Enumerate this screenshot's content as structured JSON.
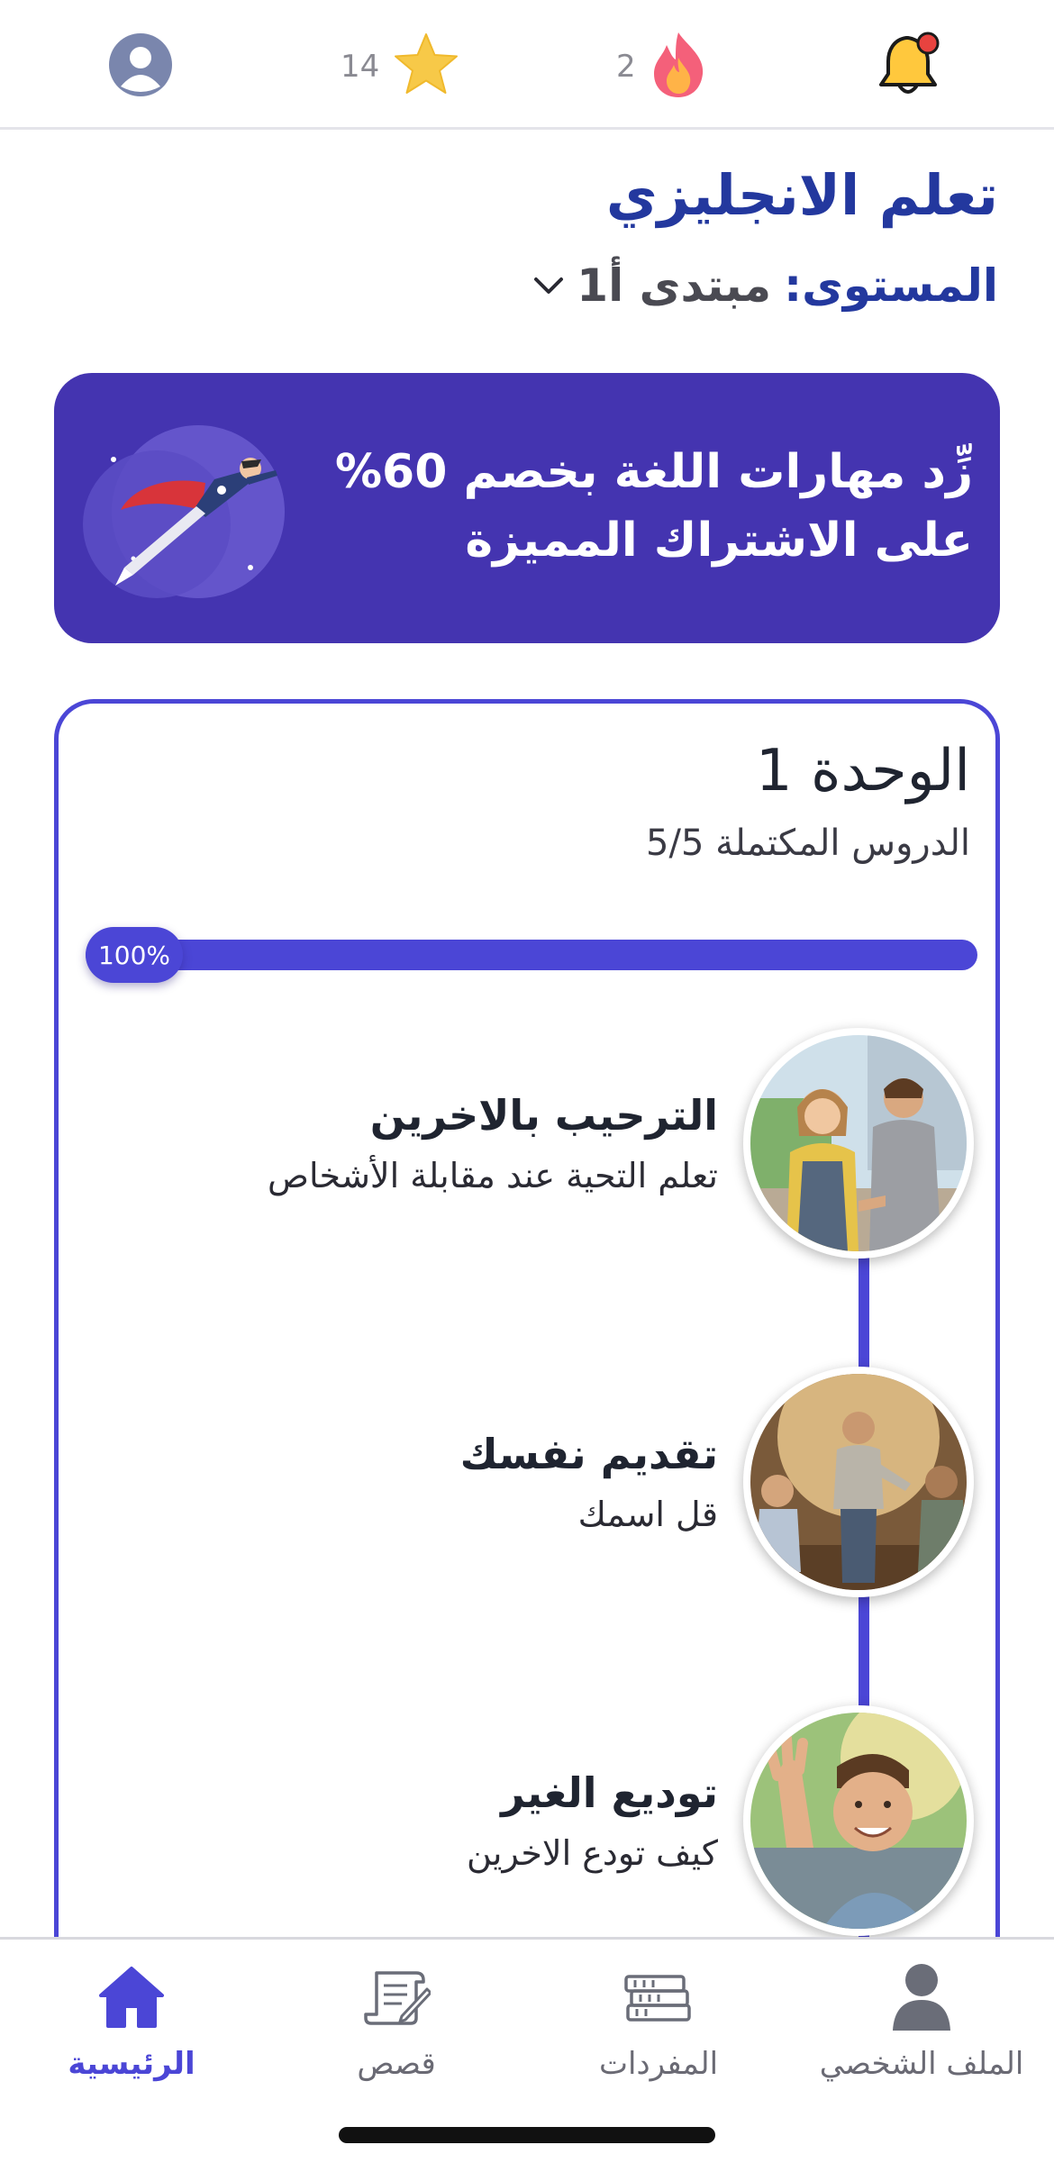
{
  "topbar": {
    "stars_count": "14",
    "streak_count": "2",
    "icons": [
      "avatar-icon",
      "star-icon",
      "flame-icon",
      "bell-icon"
    ]
  },
  "header": {
    "course_title": "تعلم الانجليزي",
    "level_label": "المستوى:",
    "level_value": "مبتدى أ1"
  },
  "promo": {
    "text": "زِّد مهارات اللغة بخصم 60% على الاشتراك المميزة"
  },
  "unit": {
    "title": "الوحدة 1",
    "completed_text": "الدروس المكتملة 5/5",
    "progress_label": "100%",
    "progress": 1.0,
    "lessons": [
      {
        "title": "الترحيب بالاخرين",
        "description": "تعلم التحية عند مقابلة الأشخاص"
      },
      {
        "title": "تقديم نفسك",
        "description": "قل اسمك"
      },
      {
        "title": "توديع الغير",
        "description": "كيف تودع الاخرين"
      }
    ]
  },
  "bottom_nav": {
    "items": [
      {
        "label": "الملف الشخصي",
        "icon": "person-icon"
      },
      {
        "label": "المفردات",
        "icon": "books-icon"
      },
      {
        "label": "قصص",
        "icon": "scroll-icon"
      },
      {
        "label": "الرئيسية",
        "icon": "home-icon",
        "active": true
      }
    ]
  },
  "colors": {
    "accent": "#4b46d6",
    "title_blue": "#23389e",
    "promo_bg": "#4434b0"
  }
}
